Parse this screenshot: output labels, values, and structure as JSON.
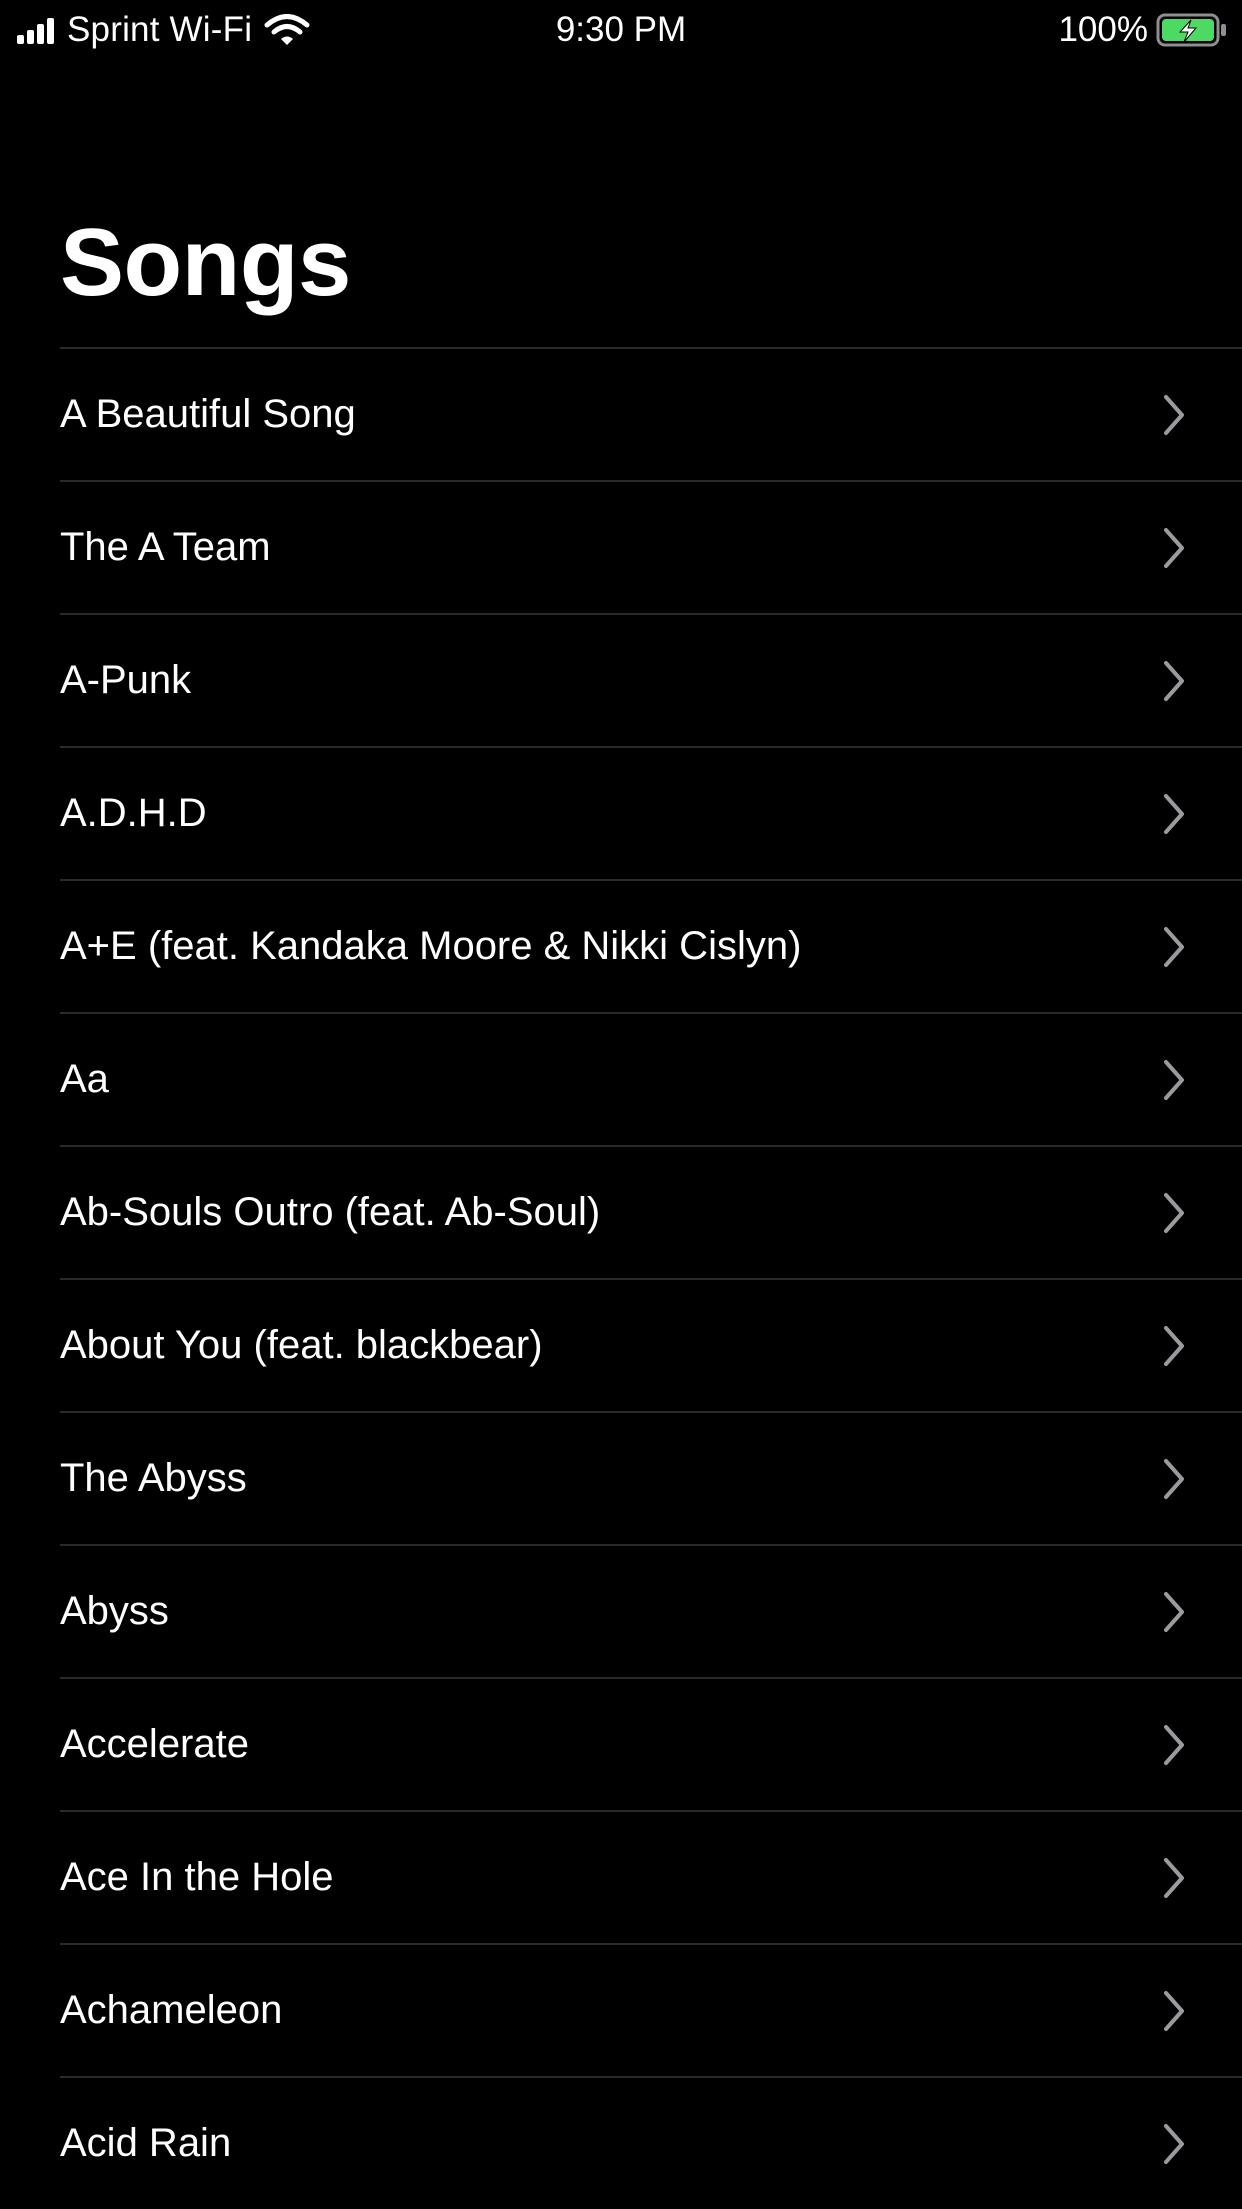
{
  "status_bar": {
    "carrier": "Sprint Wi-Fi",
    "time": "9:30 PM",
    "battery_percent": "100%",
    "icons": [
      "signal-bars-icon",
      "wifi-icon",
      "battery-charging-icon"
    ]
  },
  "header": {
    "title": "Songs"
  },
  "songs": [
    {
      "title": "A Beautiful Song"
    },
    {
      "title": "The A Team"
    },
    {
      "title": "A-Punk"
    },
    {
      "title": "A.D.H.D"
    },
    {
      "title": "A+E (feat. Kandaka Moore & Nikki Cislyn)"
    },
    {
      "title": "Aa"
    },
    {
      "title": "Ab-Souls Outro (feat. Ab-Soul)"
    },
    {
      "title": "About You (feat. blackbear)"
    },
    {
      "title": "The Abyss"
    },
    {
      "title": "Abyss"
    },
    {
      "title": "Accelerate"
    },
    {
      "title": "Ace In the Hole"
    },
    {
      "title": "Achameleon"
    },
    {
      "title": "Acid Rain"
    }
  ],
  "colors": {
    "background": "#000000",
    "text": "#ffffff",
    "separator": "#2a2a2c",
    "chevron": "#9b9b9f",
    "battery_fill": "#4cd964"
  }
}
